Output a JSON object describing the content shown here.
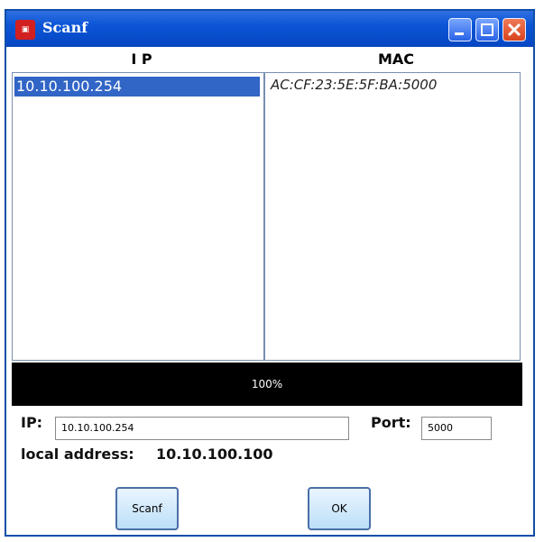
{
  "window": {
    "title": "Scanf",
    "icon": "app-logo-icon",
    "controls": [
      "minimize-icon",
      "maximize-icon",
      "close-icon"
    ],
    "colors": {
      "titlebar": "#0b55d6",
      "close": "#d8431f",
      "selection": "#3165c6"
    }
  },
  "columns": {
    "ip": "I P",
    "mac": "MAC"
  },
  "rows": [
    {
      "ip": "10.10.100.254",
      "mac": "AC:CF:23:5E:5F:BA:5000",
      "selected": true
    }
  ],
  "progress": {
    "label": "100%",
    "value": 100
  },
  "form": {
    "ip_label": "IP:",
    "ip_value": "10.10.100.254",
    "port_label": "Port:",
    "port_value": "5000",
    "local_label": "local address:",
    "local_value": "10.10.100.100"
  },
  "buttons": {
    "scan": "Scanf",
    "ok": "OK"
  }
}
